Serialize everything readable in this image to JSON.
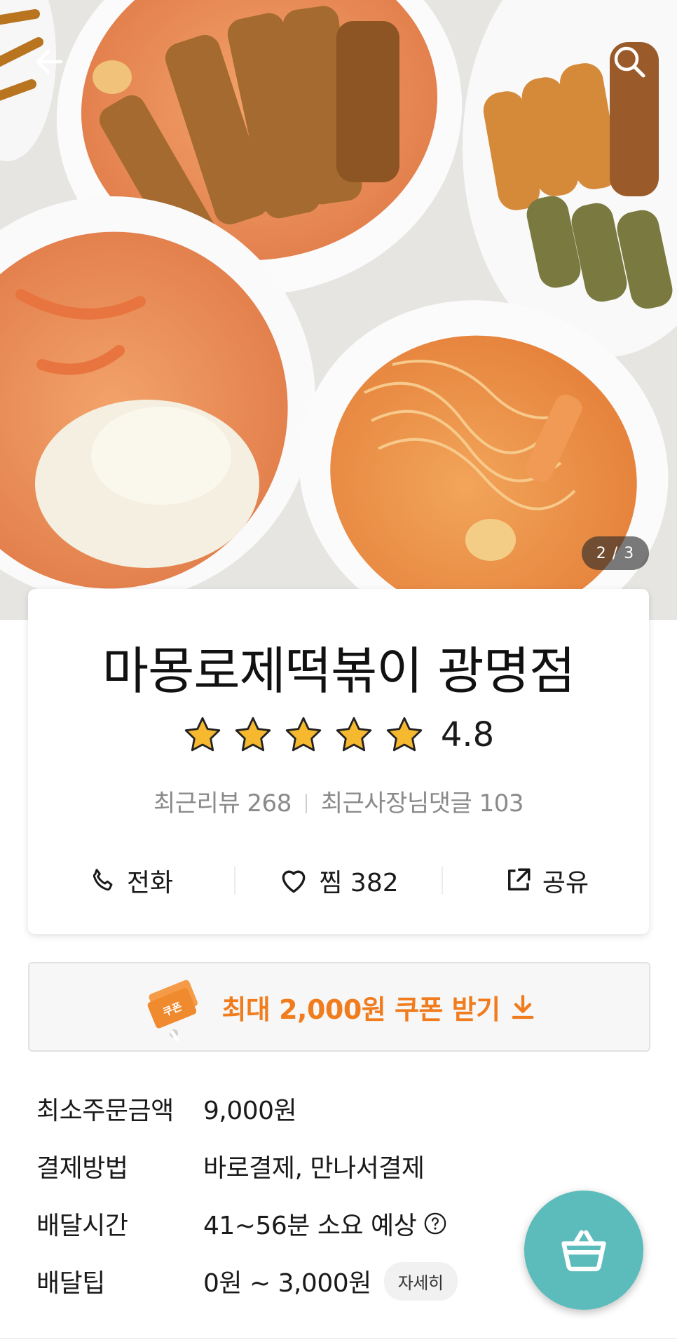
{
  "header": {
    "back_icon": "arrow-left-icon",
    "search_icon": "search-icon",
    "image_pager": "2 / 3"
  },
  "store": {
    "name": "마몽로제떡볶이 광명점",
    "rating": "4.8",
    "star_count": 5,
    "star_color": "#f5b82e",
    "recent_reviews": "최근리뷰 268",
    "owner_replies": "최근사장님댓글 103"
  },
  "actions": {
    "call_label": "전화",
    "call_icon": "phone-icon",
    "favorite_label": "찜 382",
    "favorite_icon": "heart-icon",
    "share_label": "공유",
    "share_icon": "share-icon"
  },
  "coupon": {
    "text": "최대 2,000원 쿠폰 받기",
    "ticket_text": "쿠폰",
    "accent_color": "#f07c1e",
    "icon": "download-arrow-icon"
  },
  "details": [
    {
      "label": "최소주문금액",
      "value": "9,000원"
    },
    {
      "label": "결제방법",
      "value": "바로결제, 만나서결제"
    },
    {
      "label": "배달시간",
      "value": "41~56분 소요 예상"
    },
    {
      "label": "배달팁",
      "value": "0원 ~ 3,000원",
      "button": "자세히"
    }
  ],
  "cart": {
    "icon": "basket-icon",
    "color": "#5bbcbb"
  }
}
